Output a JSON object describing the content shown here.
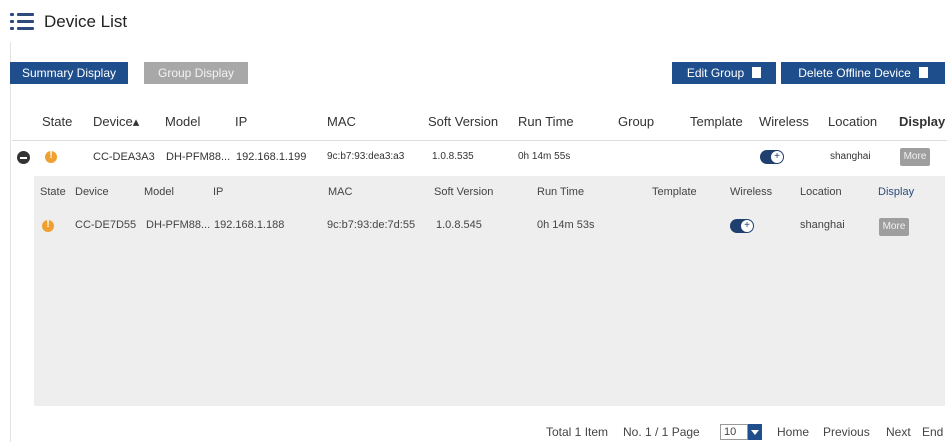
{
  "page": {
    "title": "Device List"
  },
  "toolbar": {
    "summary_display": "Summary Display",
    "group_display": "Group Display",
    "edit_group": "Edit Group",
    "delete_offline": "Delete Offline Device"
  },
  "table": {
    "headers": [
      "State",
      "Device▴",
      "Model",
      "IP",
      "MAC",
      "Soft Version",
      "Run Time",
      "Group",
      "Template",
      "Wireless",
      "Location",
      "Display"
    ],
    "row": {
      "device": "CC-DEA3A3",
      "model": "DH-PFM88...",
      "ip": "192.168.1.199",
      "mac": "9c:b7:93:dea3:a3",
      "soft_version": "1.0.8.535",
      "run_time": "0h 14m 55s",
      "location": "shanghai",
      "more": "More"
    }
  },
  "subtable": {
    "headers": [
      "State",
      "Device",
      "Model",
      "IP",
      "MAC",
      "Soft Version",
      "Run Time",
      "Template",
      "Wireless",
      "Location",
      "Display"
    ],
    "row": {
      "device": "CC-DE7D55",
      "model": "DH-PFM88...",
      "ip": "192.168.1.188",
      "mac": "9c:b7:93:de:7d:55",
      "soft_version": "1.0.8.545",
      "run_time": "0h 14m 53s",
      "location": "shanghai",
      "more": "More"
    }
  },
  "pager": {
    "total": "Total 1 Item",
    "page_info": "No. 1 / 1 Page",
    "page_size": "10",
    "home": "Home",
    "previous": "Previous",
    "next": "Next",
    "end": "End"
  },
  "colors": {
    "primary": "#1f4e8c",
    "warning": "#f0a030",
    "panel": "#eeeeee"
  },
  "icons": {
    "list": "list-icon",
    "edit": "edit-icon",
    "trash": "trash-icon",
    "wireless": "wireless-toggle-icon"
  }
}
